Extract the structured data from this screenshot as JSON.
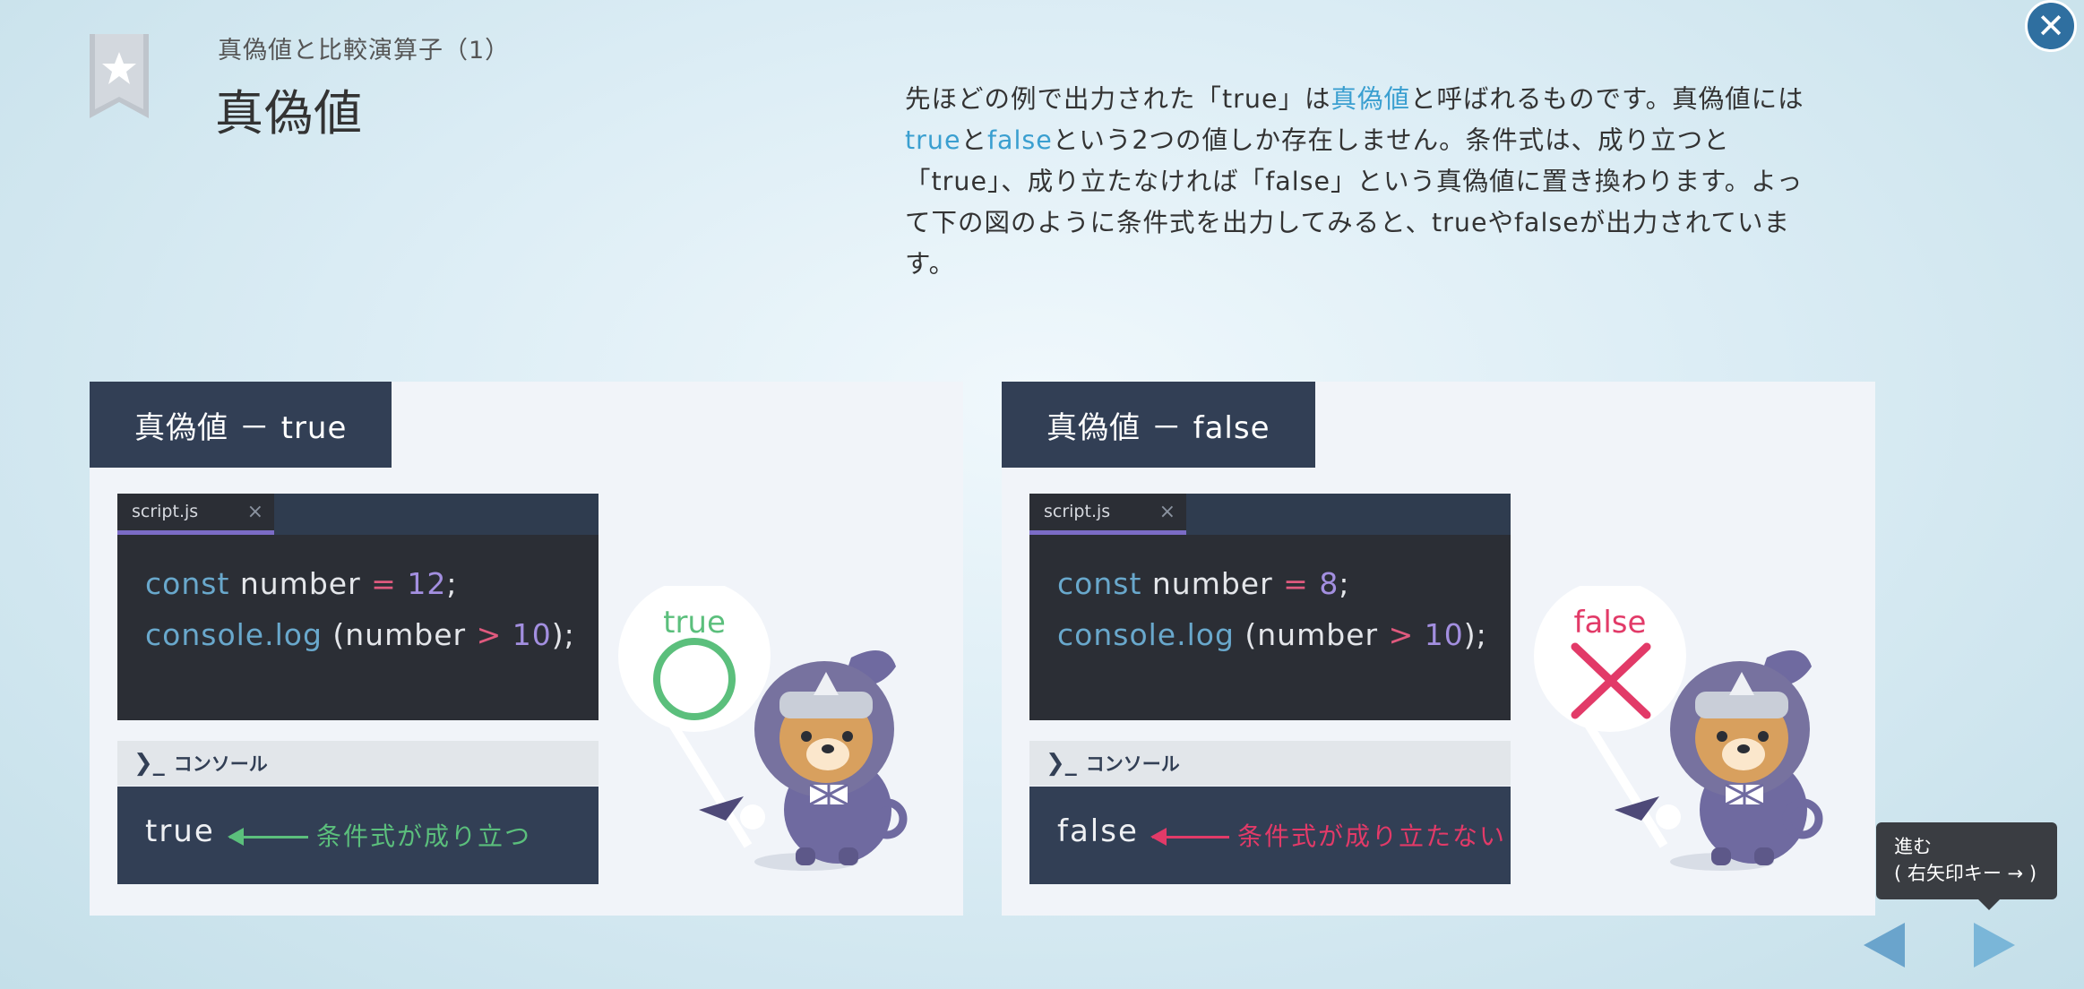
{
  "header": {
    "subtitle": "真偽値と比較演算子（1）",
    "title": "真偽値",
    "desc_part1": "先ほどの例で出力された「true」は",
    "desc_hl1": "真偽値",
    "desc_part2": "と呼ばれるものです。真偽値には",
    "desc_hl2": "true",
    "desc_part3": "と",
    "desc_hl3": "false",
    "desc_part4": "という2つの値しか存在しません。条件式は、成り立つと「true」、成り立たなければ「false」という真偽値に置き換わります。よって下の図のように条件式を出力してみると、trueやfalseが出力されています。"
  },
  "panels": [
    {
      "tab": "真偽値 － true",
      "file": "script.js",
      "file_close": "×",
      "code": {
        "l1_kw": "const",
        "l1_var": " number ",
        "l1_op": "=",
        "l1_sp": " ",
        "l1_num": "12",
        "l1_end": ";",
        "l2_kw": "console.log",
        "l2_a": " (number ",
        "l2_op": ">",
        "l2_sp": " ",
        "l2_num": "10",
        "l2_end": ");"
      },
      "console_label": "コンソール",
      "output": "true",
      "note": "条件式が成り立つ",
      "sign_label": "true",
      "accent": "#5bbf7c"
    },
    {
      "tab": "真偽値 － false",
      "file": "script.js",
      "file_close": "×",
      "code": {
        "l1_kw": "const",
        "l1_var": " number ",
        "l1_op": "=",
        "l1_sp": " ",
        "l1_num": "8",
        "l1_end": ";",
        "l2_kw": "console.log",
        "l2_a": " (number ",
        "l2_op": ">",
        "l2_sp": " ",
        "l2_num": "10",
        "l2_end": ");"
      },
      "console_label": "コンソール",
      "output": "false",
      "note": "条件式が成り立たない",
      "sign_label": "false",
      "accent": "#e23a68"
    }
  ],
  "tooltip": {
    "line1": "進む",
    "line2": "( 右矢印キー → )"
  },
  "icons": {
    "close": "close-icon",
    "bookmark": "bookmark-star-icon",
    "prev": "prev-arrow-icon",
    "next": "next-arrow-icon"
  }
}
